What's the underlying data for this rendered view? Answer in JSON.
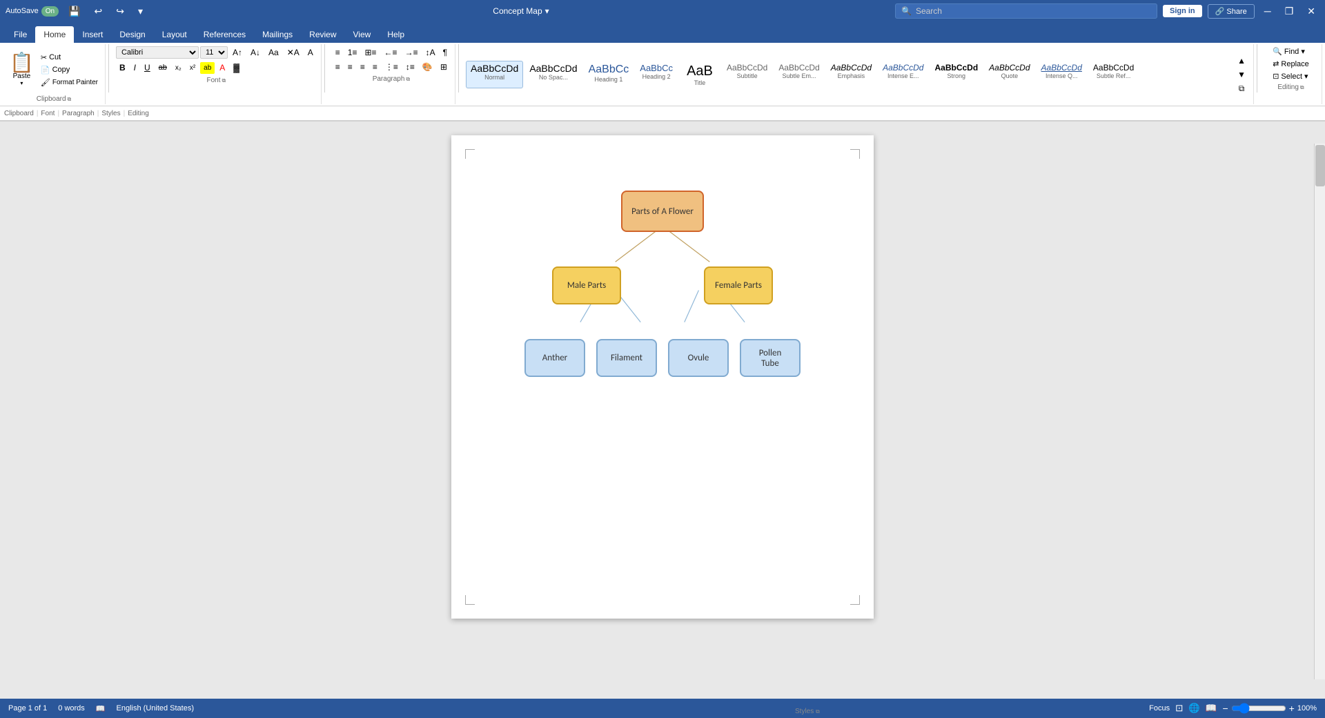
{
  "titlebar": {
    "autosave_label": "AutoSave",
    "autosave_state": "On",
    "save_icon": "💾",
    "undo_icon": "↩",
    "redo_icon": "↪",
    "customize_icon": "▾",
    "doc_title": "Concept Map",
    "doc_title_arrow": "▾",
    "search_placeholder": "Search",
    "signin_label": "Sign in",
    "share_label": "🔗 Share",
    "minimize_icon": "─",
    "restore_icon": "❐",
    "close_icon": "✕"
  },
  "ribbon_tabs": [
    {
      "label": "File",
      "active": false
    },
    {
      "label": "Home",
      "active": true
    },
    {
      "label": "Insert",
      "active": false
    },
    {
      "label": "Design",
      "active": false
    },
    {
      "label": "Layout",
      "active": false
    },
    {
      "label": "References",
      "active": false
    },
    {
      "label": "Mailings",
      "active": false
    },
    {
      "label": "Review",
      "active": false
    },
    {
      "label": "View",
      "active": false
    },
    {
      "label": "Help",
      "active": false
    }
  ],
  "ribbon": {
    "clipboard": {
      "group_label": "Clipboard",
      "paste_label": "Paste",
      "cut_label": "Cut",
      "copy_label": "Copy",
      "format_painter_label": "Format Painter"
    },
    "font": {
      "group_label": "Font",
      "font_name": "Calibri",
      "font_size": "11",
      "bold_label": "B",
      "italic_label": "I",
      "underline_label": "U",
      "strikethrough_label": "ab",
      "subscript_label": "x₂",
      "superscript_label": "x²"
    },
    "paragraph": {
      "group_label": "Paragraph"
    },
    "styles": {
      "group_label": "Styles",
      "items": [
        {
          "label": "Normal",
          "preview": "AaBbCcDd",
          "active": true
        },
        {
          "label": "No Spac...",
          "preview": "AaBbCcDd"
        },
        {
          "label": "Heading 1",
          "preview": "AaBbCc"
        },
        {
          "label": "Heading 2",
          "preview": "AaBbCc"
        },
        {
          "label": "Title",
          "preview": "AaB"
        },
        {
          "label": "Subtitle",
          "preview": "AaBbCcDd"
        },
        {
          "label": "Subtle Em...",
          "preview": "AaBbCcDd"
        },
        {
          "label": "Emphasis",
          "preview": "AaBbCcDd"
        },
        {
          "label": "Intense E...",
          "preview": "AaBbCcDd"
        },
        {
          "label": "Strong",
          "preview": "AaBbCcDd"
        },
        {
          "label": "Quote",
          "preview": "AaBbCcDd"
        },
        {
          "label": "Intense Q...",
          "preview": "AaBbCcDd"
        },
        {
          "label": "Subtle Ref...",
          "preview": "AaBbCcDd"
        }
      ]
    },
    "editing": {
      "group_label": "Editing",
      "find_label": "Find",
      "replace_label": "Replace",
      "select_label": "Select ▾"
    }
  },
  "diagram": {
    "root": {
      "text": "Parts of A Flower"
    },
    "level1_left": {
      "text": "Male Parts"
    },
    "level1_right": {
      "text": "Female Parts"
    },
    "level2": [
      {
        "text": "Anther"
      },
      {
        "text": "Filament"
      },
      {
        "text": "Ovule"
      },
      {
        "text": "Pollen Tube"
      }
    ]
  },
  "statusbar": {
    "page_label": "Page 1 of 1",
    "words_label": "0 words",
    "language_label": "English (United States)",
    "focus_label": "Focus",
    "zoom_level": "100%"
  }
}
